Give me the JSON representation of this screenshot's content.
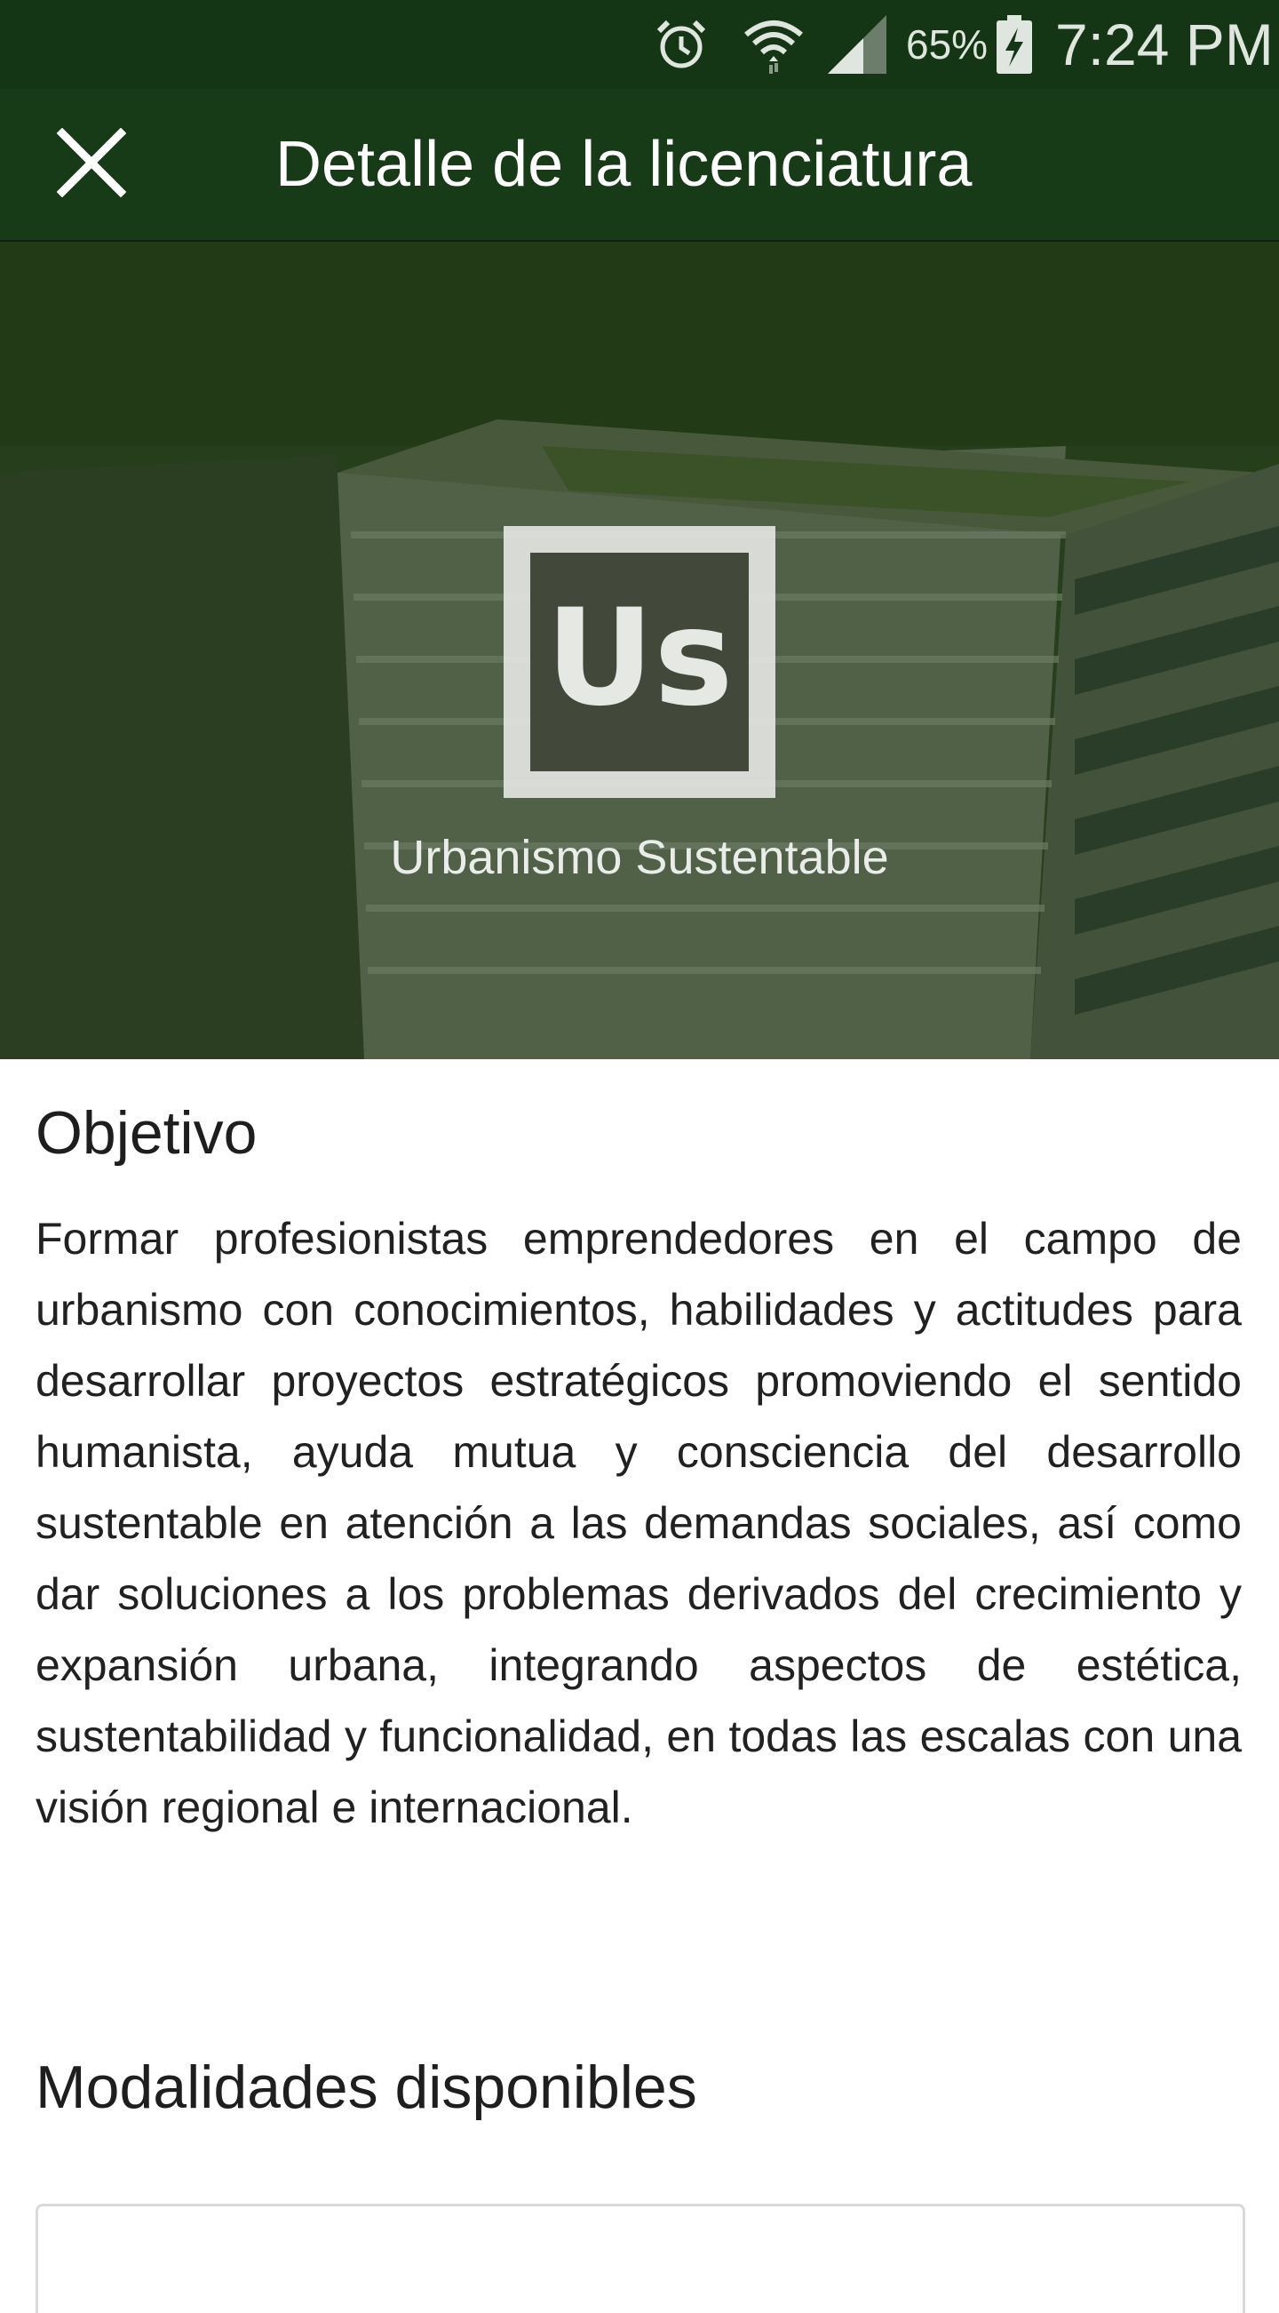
{
  "status_bar": {
    "battery_percent": "65%",
    "time": "7:24 PM",
    "icons": [
      "alarm-icon",
      "wifi-icon",
      "signal-icon",
      "battery-charging-icon"
    ]
  },
  "app_bar": {
    "title": "Detalle de la licenciatura",
    "close_icon": "close-icon"
  },
  "hero": {
    "logo_text": "Us",
    "caption": "Urbanismo Sustentable"
  },
  "objetivo": {
    "title": "Objetivo",
    "text": "Formar profesionistas emprendedores en el campo de urbanismo con conocimientos, habilidades y actitudes para desarrollar proyectos estratégicos promoviendo el sentido humanista, ayuda mutua y consciencia del desarrollo sustentable en atención a las demandas sociales, así como dar soluciones a los problemas derivados del crecimiento y expansión urbana, integrando aspectos de estética, sustentabilidad y funcionalidad, en todas las escalas con una visión regional e internacional."
  },
  "modalidades": {
    "title": "Modalidades disponibles"
  },
  "colors": {
    "status_bar": "#143614",
    "app_bar": "#173a17",
    "hero_overlay": "#1f3a14"
  }
}
